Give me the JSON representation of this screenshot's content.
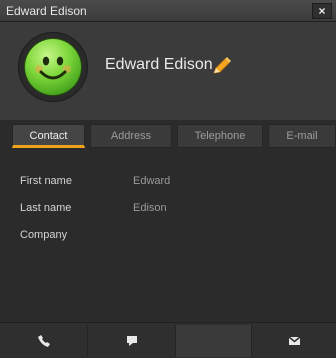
{
  "window": {
    "title": "Edward Edison",
    "close_glyph": "×"
  },
  "contact": {
    "display_name": "Edward Edison",
    "avatar_icon": "smiley-face-icon",
    "edit_icon": "pencil-icon"
  },
  "tabs": [
    {
      "label": "Contact",
      "active": true
    },
    {
      "label": "Address",
      "active": false
    },
    {
      "label": "Telephone",
      "active": false
    },
    {
      "label": "E-mail",
      "active": false
    }
  ],
  "fields": [
    {
      "label": "First name",
      "value": "Edward"
    },
    {
      "label": "Last name",
      "value": "Edison"
    },
    {
      "label": "Company",
      "value": ""
    }
  ],
  "actions": [
    {
      "name": "call-icon"
    },
    {
      "name": "chat-icon"
    },
    {
      "name": "empty-disabled-slot"
    },
    {
      "name": "email-icon"
    }
  ],
  "colors": {
    "accent": "#f0a21a",
    "avatar_green": "#7fd83b"
  }
}
